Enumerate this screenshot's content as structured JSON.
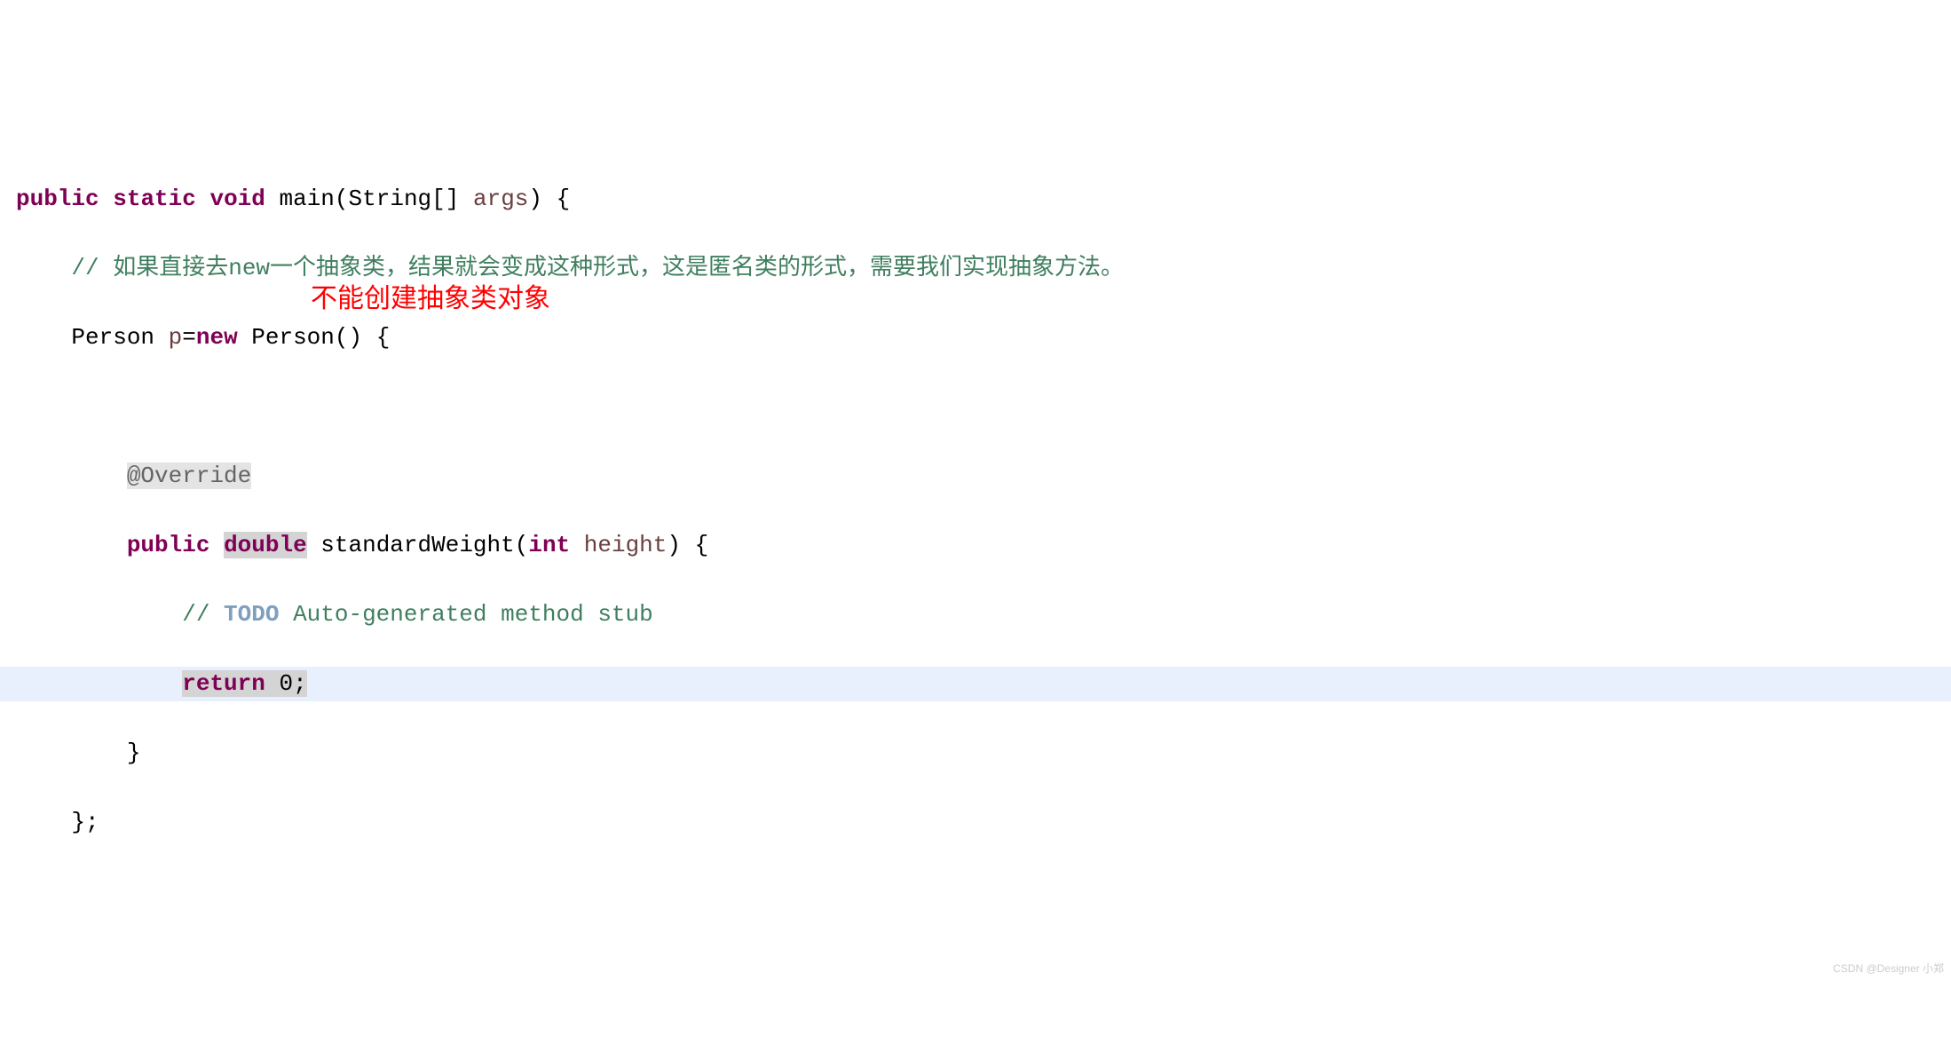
{
  "code": {
    "line1": {
      "kw_public": "public",
      "kw_static": "static",
      "kw_void": "void",
      "method": "main",
      "paren_open": "(",
      "type_string": "String",
      "brackets": "[]",
      "param": "args",
      "paren_close": ")",
      "brace": " {"
    },
    "line2": {
      "indent": "    ",
      "comment": "// 如果直接去new一个抽象类，结果就会变成这种形式，这是匿名类的形式，需要我们实现抽象方法。"
    },
    "line3": {
      "indent": "    ",
      "type": "Person ",
      "var": "p",
      "eq": "=",
      "kw_new": "new",
      "ctor": " Person() {"
    },
    "line4": "",
    "line5": {
      "indent": "        ",
      "annotation": "@Override"
    },
    "line6": {
      "indent": "        ",
      "kw_public": "public",
      "sp1": " ",
      "kw_double": "double",
      "sp2": " ",
      "method": "standardWeight",
      "paren_open": "(",
      "kw_int": "int",
      "sp3": " ",
      "param": "height",
      "paren_close": ") {"
    },
    "line7": {
      "indent": "            ",
      "comment_start": "// ",
      "todo": "TODO",
      "comment_rest": " Auto-generated method stub"
    },
    "line8": {
      "indent": "            ",
      "kw_return": "return",
      "sp": " ",
      "val": "0",
      "semi": ";"
    },
    "line9": {
      "indent": "        ",
      "brace": "}"
    },
    "line10": {
      "indent": "    ",
      "text": "};"
    }
  },
  "overlay": {
    "annotation_text": "不能创建抽象类对象"
  },
  "watermark": "CSDN @Designer 小郑"
}
